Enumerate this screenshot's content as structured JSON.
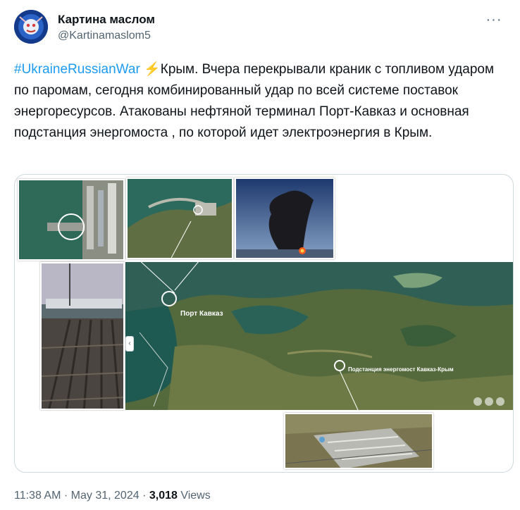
{
  "author": {
    "display_name": "Картина маслом",
    "handle": "@Kartinamaslom5",
    "icon": "person-avatar"
  },
  "menu": {
    "icon": "more-icon",
    "glyph": "···"
  },
  "tweet": {
    "hashtag": "#UkraineRussianWar",
    "emoji": "⚡",
    "body": "Крым. Вчера перекрывали краник с топливом ударом по паромам, сегодня комбинированный удар по всей системе поставок энергоресурсов. Атакованы нефтяной терминал Порт-Кавказ и основная подстанция энергомоста , по которой идет электроэнергия в Крым."
  },
  "media": {
    "map_labels": {
      "port": "Порт Кавказ",
      "substation": "Подстанция энергомост Кавказ-Крым"
    },
    "scroll_glyph": "‹"
  },
  "meta": {
    "time": "11:38 AM",
    "sep1": "·",
    "date": "May 31, 2024",
    "sep2": "·",
    "views_count": "3,018",
    "views_label": "Views"
  },
  "colors": {
    "link": "#1d9bf0",
    "text": "#0f1419",
    "secondary": "#536471",
    "border": "#cfd9de",
    "sea": "#1f5a52",
    "land": "#556b3a"
  }
}
